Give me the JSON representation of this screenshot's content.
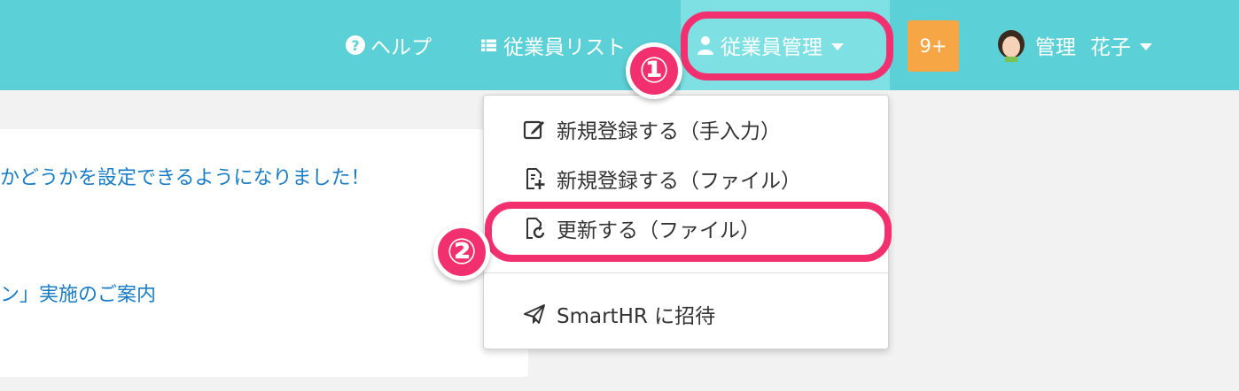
{
  "header": {
    "help_label": "ヘルプ",
    "employee_list_label": "従業員リスト",
    "employee_manage_label": "従業員管理",
    "notification_count": "9+",
    "user_last_name": "管理",
    "user_first_name": "花子"
  },
  "dropdown": {
    "items": [
      {
        "label": "新規登録する（手入力）",
        "icon": "edit-icon"
      },
      {
        "label": "新規登録する（ファイル）",
        "icon": "file-add-icon"
      },
      {
        "label": "更新する（ファイル）",
        "icon": "file-refresh-icon"
      },
      {
        "label": "SmartHR に招待",
        "icon": "paper-plane-icon"
      }
    ]
  },
  "notices": [
    "かどうかを設定できるようになりました！",
    "ン」実施のご案内"
  ],
  "annotations": {
    "step1": "①",
    "step2": "②",
    "highlight_color": "#f3306f"
  },
  "colors": {
    "header_bg": "#5bd0d6",
    "active_bg": "#7fe0e4",
    "badge_bg": "#f7a645",
    "link": "#1a7cc5"
  }
}
